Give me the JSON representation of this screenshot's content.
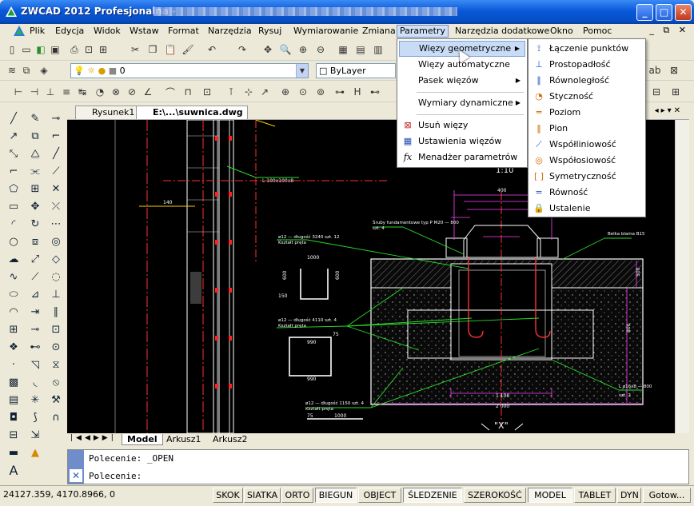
{
  "window": {
    "title": "ZWCAD 2012 Profesjonalna - ",
    "controls": {
      "minimize": "_",
      "maximize": "□",
      "close": "✕"
    }
  },
  "menubar": {
    "items": [
      "Plik",
      "Edycja",
      "Widok",
      "Wstaw",
      "Format",
      "Narzędzia",
      "Rysuj",
      "Wymiarowanie",
      "Zmiana",
      "Parametry",
      "Narzędzia dodatkowe",
      "Okno",
      "Pomoc"
    ],
    "active": "Parametry",
    "mdi_controls": "_ ⧉ ✕"
  },
  "layer_toolbar": {
    "layer_value": "0",
    "color_value": "ByLayer"
  },
  "doc_tabs": [
    "Rysunek1",
    "E:\\...\\suwnica.dwg"
  ],
  "canvas": {
    "scale_label": "1:10",
    "labels": {
      "l1": "L 100x100x8",
      "l2": "Śruby fundamentowe typ P M20 — 800",
      "l2b": "szt. 4",
      "l3": "ø12 — długość 3240 szt. 12",
      "l3b": "Kształt pręta",
      "l4": "ø12 — długość 4110 szt. 4",
      "l4b": "Kształt pręta",
      "l5": "ø12 — długość 1150 szt. 4",
      "l5b": "Kształt pręta",
      "l6": "Belka blama B15",
      "l7": "L ø16x8 — 800",
      "l7b": "szt. 2",
      "d1000": "1000",
      "d990a": "990",
      "d990b": "990",
      "d1100": "1 100",
      "d2000": "2 000",
      "d400": "400",
      "d500": "500",
      "d800": "800",
      "d150": "150",
      "d75": "75",
      "section": "\"X\""
    }
  },
  "layout_tabs": [
    "Model",
    "Arkusz1",
    "Arkusz2"
  ],
  "command": {
    "line1": "Polecenie:  _OPEN",
    "line2": "Polecenie:"
  },
  "status": {
    "coords": "24127.359,  4170.8966,  0",
    "buttons": [
      "SKOK",
      "SIATKA",
      "ORTO",
      "BIEGUN",
      "OBJECT",
      "ŚLEDZENIE",
      "SZEROKOŚĆ",
      "MODEL",
      "TABLET",
      "DYN",
      "Gotow..."
    ],
    "on": [
      "BIEGUN",
      "ŚLEDZENIE",
      "MODEL"
    ]
  },
  "parametry_menu": {
    "items": [
      {
        "label": "Więzy geometryczne",
        "submenu": true,
        "icon": ""
      },
      {
        "label": "Więzy automatyczne",
        "submenu": false,
        "icon": ""
      },
      {
        "label": "Pasek więzów",
        "submenu": true,
        "icon": ""
      },
      {
        "label": "Wymiary dynamiczne",
        "submenu": true,
        "icon": ""
      },
      {
        "label": "Usuń więzy",
        "submenu": false,
        "icon": "delete-constraints-icon"
      },
      {
        "label": "Ustawienia więzów",
        "submenu": false,
        "icon": "constraint-settings-icon"
      },
      {
        "label": "Menadżer parametrów",
        "submenu": false,
        "icon": "fx-icon"
      }
    ],
    "highlighted": "Więzy geometryczne"
  },
  "geometric_submenu": {
    "items": [
      {
        "label": "Łączenie punktów",
        "icon": "coincident-icon",
        "glyph": "⟟",
        "color": "#1a56c8"
      },
      {
        "label": "Prostopadłość",
        "icon": "perpendicular-icon",
        "glyph": "⊥",
        "color": "#1a56c8"
      },
      {
        "label": "Równoległość",
        "icon": "parallel-icon",
        "glyph": "∥",
        "color": "#1a56c8"
      },
      {
        "label": "Styczność",
        "icon": "tangent-icon",
        "glyph": "◔",
        "color": "#d46a00"
      },
      {
        "label": "Poziom",
        "icon": "horizontal-icon",
        "glyph": "═",
        "color": "#d46a00"
      },
      {
        "label": "Pion",
        "icon": "vertical-icon",
        "glyph": "‖",
        "color": "#d46a00"
      },
      {
        "label": "Współliniowość",
        "icon": "collinear-icon",
        "glyph": "⟋",
        "color": "#1a56c8"
      },
      {
        "label": "Współosiowość",
        "icon": "concentric-icon",
        "glyph": "◎",
        "color": "#d46a00"
      },
      {
        "label": "Symetryczność",
        "icon": "symmetric-icon",
        "glyph": "[ ]",
        "color": "#d46a00"
      },
      {
        "label": "Równość",
        "icon": "equal-icon",
        "glyph": "=",
        "color": "#1a56c8"
      },
      {
        "label": "Ustalenie",
        "icon": "fix-lock-icon",
        "glyph": "🔒",
        "color": "#444"
      }
    ]
  }
}
